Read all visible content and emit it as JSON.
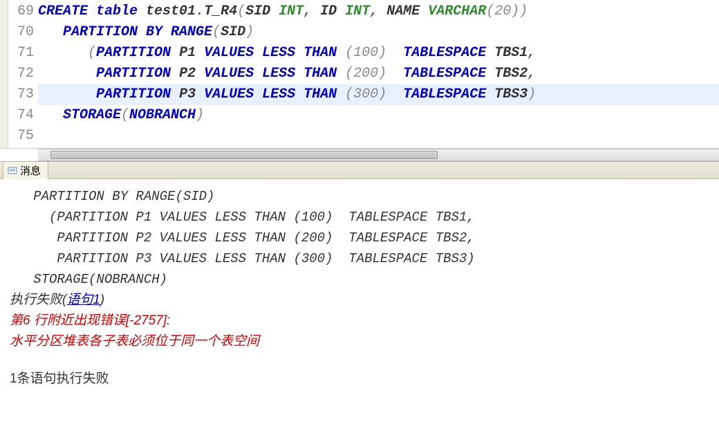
{
  "editor": {
    "lines": [
      {
        "num": "69",
        "tokens": [
          {
            "t": "CREATE table",
            "cls": "kw-blue"
          },
          {
            "t": " ",
            "cls": "plain"
          },
          {
            "t": "test01",
            "cls": "plain-b"
          },
          {
            "t": ".",
            "cls": "plain"
          },
          {
            "t": "T_R4",
            "cls": "plain-b"
          },
          {
            "t": "(",
            "cls": "paren"
          },
          {
            "t": "SID ",
            "cls": "plain-b"
          },
          {
            "t": "INT",
            "cls": "kw-green"
          },
          {
            "t": ", ",
            "cls": "plain"
          },
          {
            "t": "ID ",
            "cls": "plain-b"
          },
          {
            "t": "INT",
            "cls": "kw-green"
          },
          {
            "t": ", ",
            "cls": "plain"
          },
          {
            "t": "NAME ",
            "cls": "plain-b"
          },
          {
            "t": "VARCHAR",
            "cls": "kw-green"
          },
          {
            "t": "(",
            "cls": "paren"
          },
          {
            "t": "20",
            "cls": "gray-num"
          },
          {
            "t": "))",
            "cls": "paren"
          }
        ]
      },
      {
        "num": "70",
        "tokens": [
          {
            "t": "   ",
            "cls": "plain"
          },
          {
            "t": "PARTITION BY RANGE",
            "cls": "kw-blue"
          },
          {
            "t": "(",
            "cls": "paren"
          },
          {
            "t": "SID",
            "cls": "plain-b"
          },
          {
            "t": ")",
            "cls": "paren"
          }
        ]
      },
      {
        "num": "71",
        "tokens": [
          {
            "t": "      ",
            "cls": "plain"
          },
          {
            "t": "(",
            "cls": "paren"
          },
          {
            "t": "PARTITION",
            "cls": "kw-blue"
          },
          {
            "t": " ",
            "cls": "plain"
          },
          {
            "t": "P1",
            "cls": "plain-b"
          },
          {
            "t": " ",
            "cls": "plain"
          },
          {
            "t": "VALUES LESS THAN",
            "cls": "kw-blue"
          },
          {
            "t": " (",
            "cls": "paren"
          },
          {
            "t": "100",
            "cls": "gray-num"
          },
          {
            "t": ")  ",
            "cls": "paren"
          },
          {
            "t": "TABLESPACE",
            "cls": "kw-blue"
          },
          {
            "t": " ",
            "cls": "plain"
          },
          {
            "t": "TBS1",
            "cls": "plain-b"
          },
          {
            "t": ",",
            "cls": "plain"
          }
        ]
      },
      {
        "num": "72",
        "tokens": [
          {
            "t": "       ",
            "cls": "plain"
          },
          {
            "t": "PARTITION",
            "cls": "kw-blue"
          },
          {
            "t": " ",
            "cls": "plain"
          },
          {
            "t": "P2",
            "cls": "plain-b"
          },
          {
            "t": " ",
            "cls": "plain"
          },
          {
            "t": "VALUES LESS THAN",
            "cls": "kw-blue"
          },
          {
            "t": " (",
            "cls": "paren"
          },
          {
            "t": "200",
            "cls": "gray-num"
          },
          {
            "t": ")  ",
            "cls": "paren"
          },
          {
            "t": "TABLESPACE",
            "cls": "kw-blue"
          },
          {
            "t": " ",
            "cls": "plain"
          },
          {
            "t": "TBS2",
            "cls": "plain-b"
          },
          {
            "t": ",",
            "cls": "plain"
          }
        ]
      },
      {
        "num": "73",
        "highlight": true,
        "tokens": [
          {
            "t": "       ",
            "cls": "plain"
          },
          {
            "t": "PARTITION",
            "cls": "kw-blue"
          },
          {
            "t": " ",
            "cls": "plain"
          },
          {
            "t": "P3",
            "cls": "plain-b"
          },
          {
            "t": " ",
            "cls": "plain"
          },
          {
            "t": "VALUES LESS THAN",
            "cls": "kw-blue"
          },
          {
            "t": " (",
            "cls": "paren"
          },
          {
            "t": "300",
            "cls": "gray-num"
          },
          {
            "t": ")  ",
            "cls": "paren"
          },
          {
            "t": "TABLESPACE",
            "cls": "kw-blue"
          },
          {
            "t": " ",
            "cls": "plain"
          },
          {
            "t": "TBS3",
            "cls": "plain-b"
          },
          {
            "t": ")",
            "cls": "paren"
          }
        ]
      },
      {
        "num": "74",
        "tokens": [
          {
            "t": "   ",
            "cls": "plain"
          },
          {
            "t": "STORAGE",
            "cls": "kw-blue"
          },
          {
            "t": "(",
            "cls": "paren"
          },
          {
            "t": "NOBRANCH",
            "cls": "kw-blue"
          },
          {
            "t": ")",
            "cls": "paren"
          }
        ]
      },
      {
        "num": "75",
        "tokens": []
      }
    ]
  },
  "tab": {
    "label": "消息"
  },
  "output": {
    "mono_lines": [
      "   PARTITION BY RANGE(SID)",
      "     (PARTITION P1 VALUES LESS THAN (100)  TABLESPACE TBS1,",
      "      PARTITION P2 VALUES LESS THAN (200)  TABLESPACE TBS2,",
      "      PARTITION P3 VALUES LESS THAN (300)  TABLESPACE TBS3)",
      "   STORAGE(NOBRANCH)"
    ],
    "fail_prefix": "执行失败(",
    "fail_link": "语句1",
    "fail_suffix": ")",
    "err1": "第6 行附近出现错误[-2757]:",
    "err2": "水平分区堆表各子表必须位于同一个表空间",
    "summary": "1条语句执行失败"
  }
}
